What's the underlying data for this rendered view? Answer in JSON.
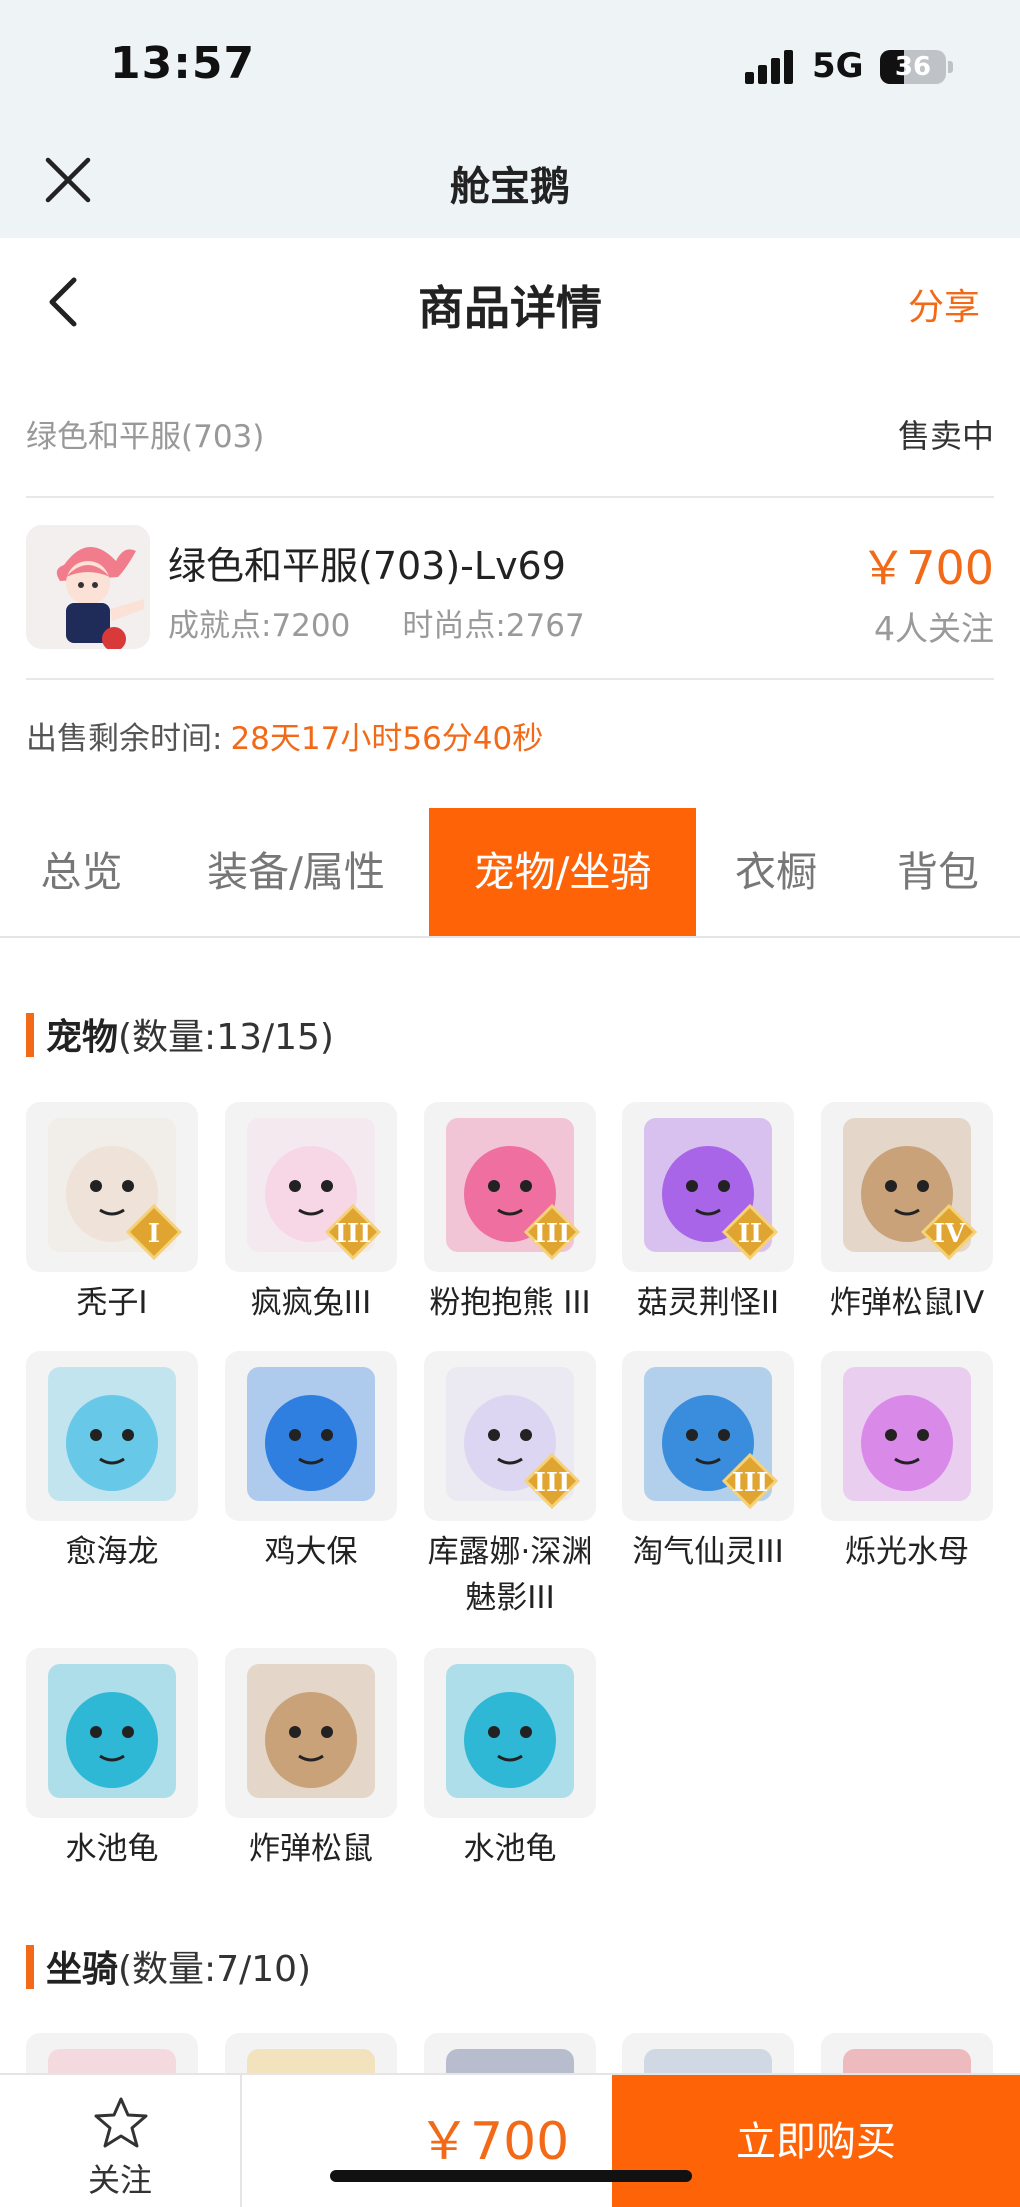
{
  "status": {
    "time": "13:57",
    "network": "5G",
    "battery": "36"
  },
  "app_bar": {
    "title": "舱宝鹅"
  },
  "nav": {
    "title": "商品详情",
    "share": "分享"
  },
  "product": {
    "server": "绿色和平服(703)",
    "status": "售卖中",
    "role_name": "绿色和平服(703)-Lv69",
    "achievement": "成就点:7200",
    "fashion": "时尚点:2767",
    "price": "￥700",
    "followers": "4人关注",
    "remaining_label": "出售剩余时间:",
    "remaining_value": "28天17小时56分40秒"
  },
  "tabs": [
    {
      "label": "总览",
      "active": false
    },
    {
      "label": "装备/属性",
      "active": false
    },
    {
      "label": "宠物/坐骑",
      "active": true
    },
    {
      "label": "衣橱",
      "active": false
    },
    {
      "label": "背包",
      "active": false
    }
  ],
  "pets": {
    "title": "宠物",
    "count": "(数量:13/15)",
    "items": [
      {
        "name": "秃子I",
        "icon": "bald-bun-pet-icon",
        "color": "#efe2d8",
        "badge": "I"
      },
      {
        "name": "疯疯兔III",
        "icon": "crazy-rabbit-pet-icon",
        "color": "#f7d7e6",
        "badge": "III"
      },
      {
        "name": "粉抱抱熊 III",
        "icon": "pink-hug-bear-pet-icon",
        "color": "#ef6fa0",
        "badge": "III"
      },
      {
        "name": "菇灵荆怪II",
        "icon": "mushroom-sprite-pet-icon",
        "color": "#a865e8",
        "badge": "II"
      },
      {
        "name": "炸弹松鼠IV",
        "icon": "bomb-squirrel-pet-icon",
        "color": "#c9a27a",
        "badge": "IV"
      },
      {
        "name": "愈海龙",
        "icon": "sea-dragon-pet-icon",
        "color": "#67c8e8",
        "badge": ""
      },
      {
        "name": "鸡大保",
        "icon": "chicken-boss-pet-icon",
        "color": "#2f7fe0",
        "badge": ""
      },
      {
        "name": "库露娜·深渊魅影III",
        "icon": "kuluna-abyss-phantom-pet-icon",
        "color": "#dcd6f2",
        "badge": "III"
      },
      {
        "name": "淘气仙灵III",
        "icon": "naughty-fairy-pet-icon",
        "color": "#3a8ddc",
        "badge": "III"
      },
      {
        "name": "烁光水母",
        "icon": "glowing-jellyfish-pet-icon",
        "color": "#d98ae8",
        "badge": ""
      },
      {
        "name": "水池龟",
        "icon": "pool-turtle-pet-icon",
        "color": "#2fb8d6",
        "badge": ""
      },
      {
        "name": "炸弹松鼠",
        "icon": "bomb-squirrel-pet-icon",
        "color": "#c9a27a",
        "badge": ""
      },
      {
        "name": "水池龟",
        "icon": "pool-turtle-pet-icon",
        "color": "#2fb8d6",
        "badge": ""
      }
    ]
  },
  "mounts": {
    "title": "坐骑",
    "count": "(数量:7/10)",
    "items": [
      {
        "icon": "mount-icon",
        "color": "#f7a9b8"
      },
      {
        "icon": "mount-icon",
        "color": "#f0c35a"
      },
      {
        "icon": "mount-icon",
        "color": "#4a5a8a"
      },
      {
        "icon": "mount-icon",
        "color": "#8fa6c9"
      },
      {
        "icon": "mount-icon",
        "color": "#e2505a"
      }
    ]
  },
  "bottom": {
    "follow": "关注",
    "price": "￥700",
    "buy": "立即购买"
  },
  "colors": {
    "accent": "#ff6307",
    "price": "#f26a17"
  }
}
